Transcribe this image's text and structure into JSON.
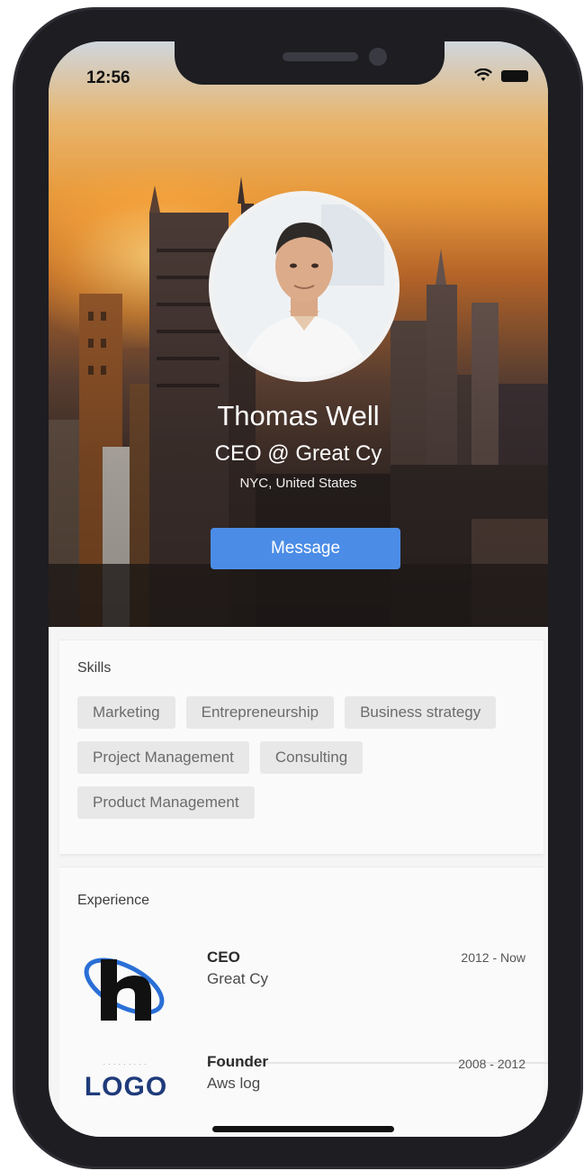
{
  "status_bar": {
    "time": "12:56",
    "wifi_icon": "wifi-icon",
    "battery_icon": "battery-icon"
  },
  "profile": {
    "name": "Thomas Well",
    "title": "CEO @ Great Cy",
    "location": "NYC, United States",
    "message_button": "Message",
    "accent_color": "#4b8de6"
  },
  "skills": {
    "heading": "Skills",
    "tags": [
      "Marketing",
      "Entrepreneurship",
      "Business strategy",
      "Project Management",
      "Consulting",
      "Product Management"
    ]
  },
  "experience": {
    "heading": "Experience",
    "items": [
      {
        "role": "CEO",
        "company": "Great Cy",
        "dates": "2012 - Now"
      },
      {
        "role": "Founder",
        "company": "Aws log",
        "dates": "2008 - 2012",
        "logo_text": "LOGO"
      }
    ]
  }
}
